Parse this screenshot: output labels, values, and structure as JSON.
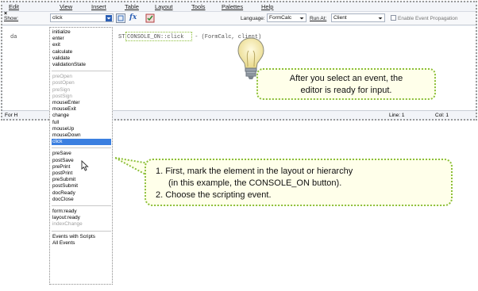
{
  "menu": [
    "Edit",
    "View",
    "Insert",
    "Table",
    "Layout",
    "Tools",
    "Palettes",
    "Help"
  ],
  "toolbar": {
    "show_label": "Show:",
    "show_value": "click",
    "fx_label": "fx",
    "language_label": "Language:",
    "language_value": "FormCalc",
    "run_at_label": "Run At:",
    "run_at_value": "Client",
    "enable_propagation_label": "Enable Event Propagation"
  },
  "editor": {
    "gutter_text": "da",
    "code_prefix": "ST",
    "code_highlight": "CONSOLE_ON::click",
    "code_rest": " - (FormCalc, client)"
  },
  "status": {
    "left": "For H",
    "line": "Line: 1",
    "col": "Col: 1"
  },
  "dropdown": {
    "items": [
      {
        "label": "initialize",
        "state": "normal"
      },
      {
        "label": "enter",
        "state": "normal"
      },
      {
        "label": "exit",
        "state": "normal"
      },
      {
        "label": "calculate",
        "state": "normal"
      },
      {
        "label": "validate",
        "state": "normal"
      },
      {
        "label": "validationState",
        "state": "normal"
      },
      {
        "label": "",
        "state": "separator"
      },
      {
        "label": "preOpen",
        "state": "disabled"
      },
      {
        "label": "postOpen",
        "state": "disabled"
      },
      {
        "label": "preSign",
        "state": "disabled"
      },
      {
        "label": "postSign",
        "state": "disabled"
      },
      {
        "label": "mouseEnter",
        "state": "normal"
      },
      {
        "label": "mouseExit",
        "state": "normal"
      },
      {
        "label": "change",
        "state": "normal"
      },
      {
        "label": "full",
        "state": "normal"
      },
      {
        "label": "mouseUp",
        "state": "normal"
      },
      {
        "label": "mouseDown",
        "state": "normal"
      },
      {
        "label": "click",
        "state": "selected"
      },
      {
        "label": "",
        "state": "separator"
      },
      {
        "label": "preSave",
        "state": "normal"
      },
      {
        "label": "postSave",
        "state": "normal"
      },
      {
        "label": "prePrint",
        "state": "normal"
      },
      {
        "label": "postPrint",
        "state": "normal"
      },
      {
        "label": "preSubmit",
        "state": "normal"
      },
      {
        "label": "postSubmit",
        "state": "normal"
      },
      {
        "label": "docReady",
        "state": "normal"
      },
      {
        "label": "docClose",
        "state": "normal"
      },
      {
        "label": "",
        "state": "separator"
      },
      {
        "label": "form:ready",
        "state": "normal"
      },
      {
        "label": "layout:ready",
        "state": "normal"
      },
      {
        "label": "indexChange",
        "state": "disabled"
      },
      {
        "label": "",
        "state": "separator"
      },
      {
        "label": "Events with Scripts",
        "state": "normal"
      },
      {
        "label": "All Events",
        "state": "normal"
      }
    ]
  },
  "callout_top": {
    "line1": "After you select an event, the",
    "line2": "editor is ready for input."
  },
  "callout_bottom": {
    "line1": "1. First, mark the element in the layout or hierarchy",
    "line2": "(in this example, the CONSOLE_ON button).",
    "line3": "2. Choose the scripting event."
  },
  "colors": {
    "accent_green": "#8cbf3a",
    "selection_blue": "#3b7fe0",
    "callout_bg": "#ffffea"
  }
}
